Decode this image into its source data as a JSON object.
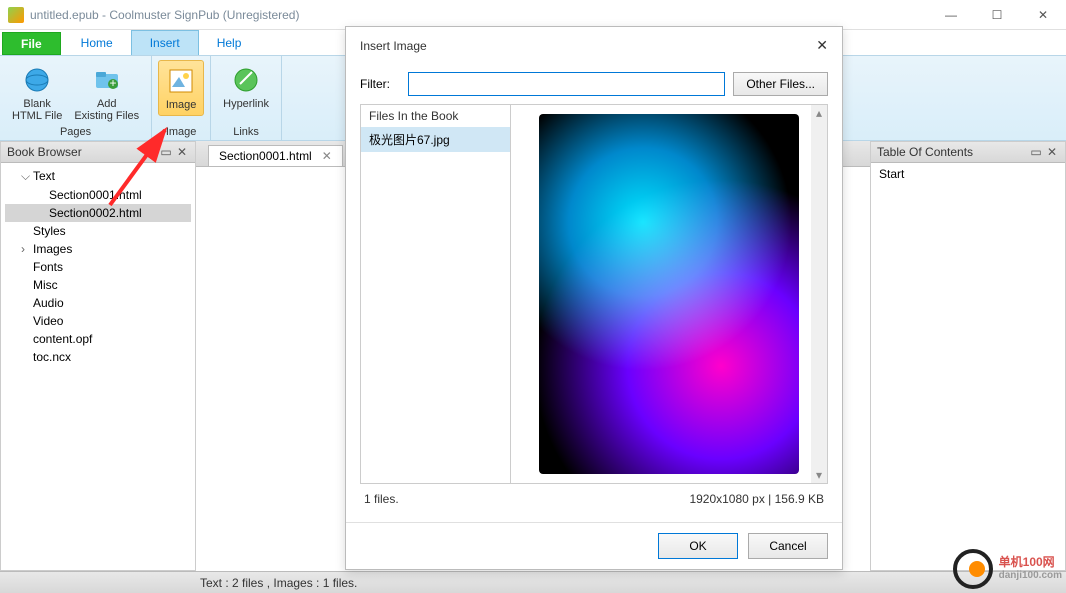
{
  "window": {
    "title": "untitled.epub - Coolmuster SignPub (Unregistered)"
  },
  "menubar": {
    "file": "File",
    "home": "Home",
    "insert": "Insert",
    "help": "Help"
  },
  "ribbon": {
    "blank_html": "Blank\nHTML File",
    "add_existing": "Add\nExisting Files",
    "image": "Image",
    "hyperlink": "Hyperlink",
    "group_pages": "Pages",
    "group_image": "Image",
    "group_links": "Links"
  },
  "book_browser": {
    "title": "Book Browser",
    "items": [
      {
        "label": "Text",
        "level": 1,
        "expanded": true
      },
      {
        "label": "Section0001.html",
        "level": 2
      },
      {
        "label": "Section0002.html",
        "level": 2,
        "selected": true
      },
      {
        "label": "Styles",
        "level": 1
      },
      {
        "label": "Images",
        "level": 1,
        "arrow": true
      },
      {
        "label": "Fonts",
        "level": 1
      },
      {
        "label": "Misc",
        "level": 1
      },
      {
        "label": "Audio",
        "level": 1
      },
      {
        "label": "Video",
        "level": 1
      },
      {
        "label": "content.opf",
        "level": 1
      },
      {
        "label": "toc.ncx",
        "level": 1
      }
    ]
  },
  "tab": {
    "label": "Section0001.html"
  },
  "toc": {
    "title": "Table Of Contents",
    "item": "Start"
  },
  "status": "Text : 2 files , Images : 1 files.",
  "dialog": {
    "title": "Insert Image",
    "filter_label": "Filter:",
    "filter_value": "",
    "other_files": "Other Files...",
    "files_header": "Files In the Book",
    "file_item": "极光图片67.jpg",
    "file_count": "1 files.",
    "dimensions": "1920x1080 px | 156.9 KB",
    "ok": "OK",
    "cancel": "Cancel"
  },
  "watermark": {
    "brand": "单机100网",
    "url": "danji100.com"
  }
}
